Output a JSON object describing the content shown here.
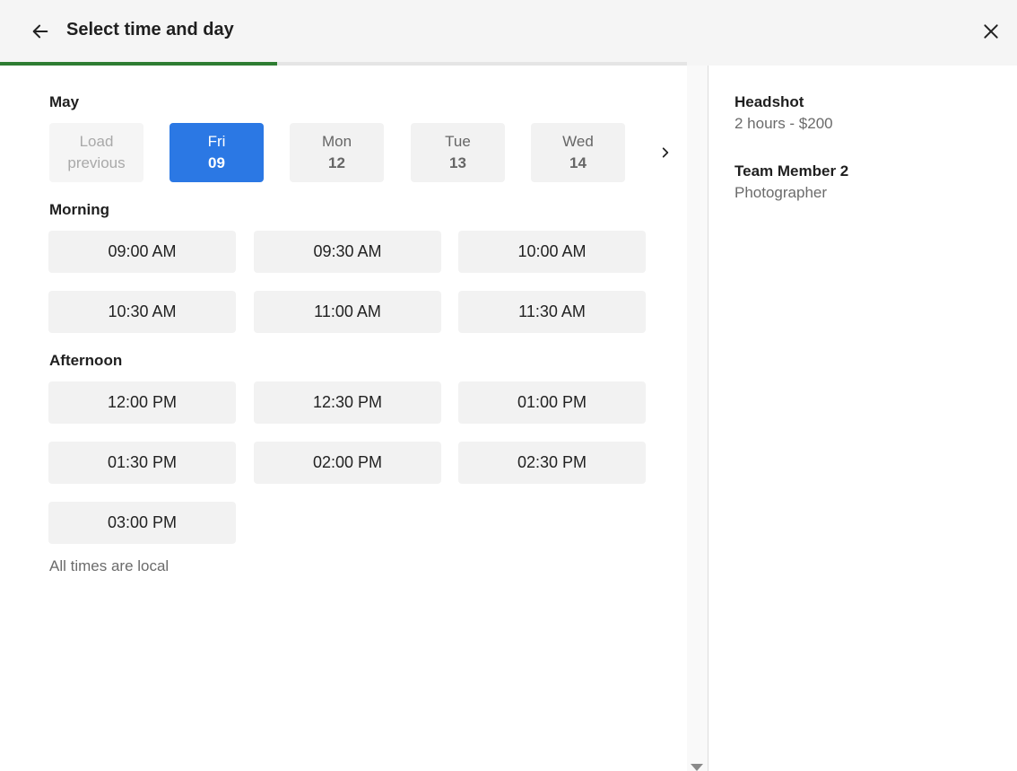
{
  "header": {
    "title": "Select time and day",
    "back_icon": "arrow-left-icon",
    "close_icon": "close-icon"
  },
  "progress": {
    "percent": 40.3,
    "color": "#2e7d32"
  },
  "calendar": {
    "month": "May",
    "load_previous": {
      "line1": "Load",
      "line2": "previous"
    },
    "days": [
      {
        "weekday": "Fri",
        "day": "09",
        "selected": true
      },
      {
        "weekday": "Mon",
        "day": "12",
        "selected": false
      },
      {
        "weekday": "Tue",
        "day": "13",
        "selected": false
      },
      {
        "weekday": "Wed",
        "day": "14",
        "selected": false
      }
    ],
    "next_icon": "chevron-right-icon",
    "selected_color": "#2b78e4"
  },
  "morning": {
    "label": "Morning",
    "slots": [
      "09:00 AM",
      "09:30 AM",
      "10:00 AM",
      "10:30 AM",
      "11:00 AM",
      "11:30 AM"
    ]
  },
  "afternoon": {
    "label": "Afternoon",
    "slots": [
      "12:00 PM",
      "12:30 PM",
      "01:00 PM",
      "01:30 PM",
      "02:00 PM",
      "02:30 PM",
      "03:00 PM"
    ]
  },
  "footnote": "All times are local",
  "summary": {
    "service": {
      "name": "Headshot",
      "detail": "2 hours - $200"
    },
    "staff": {
      "name": "Team Member 2",
      "role": "Photographer"
    }
  }
}
